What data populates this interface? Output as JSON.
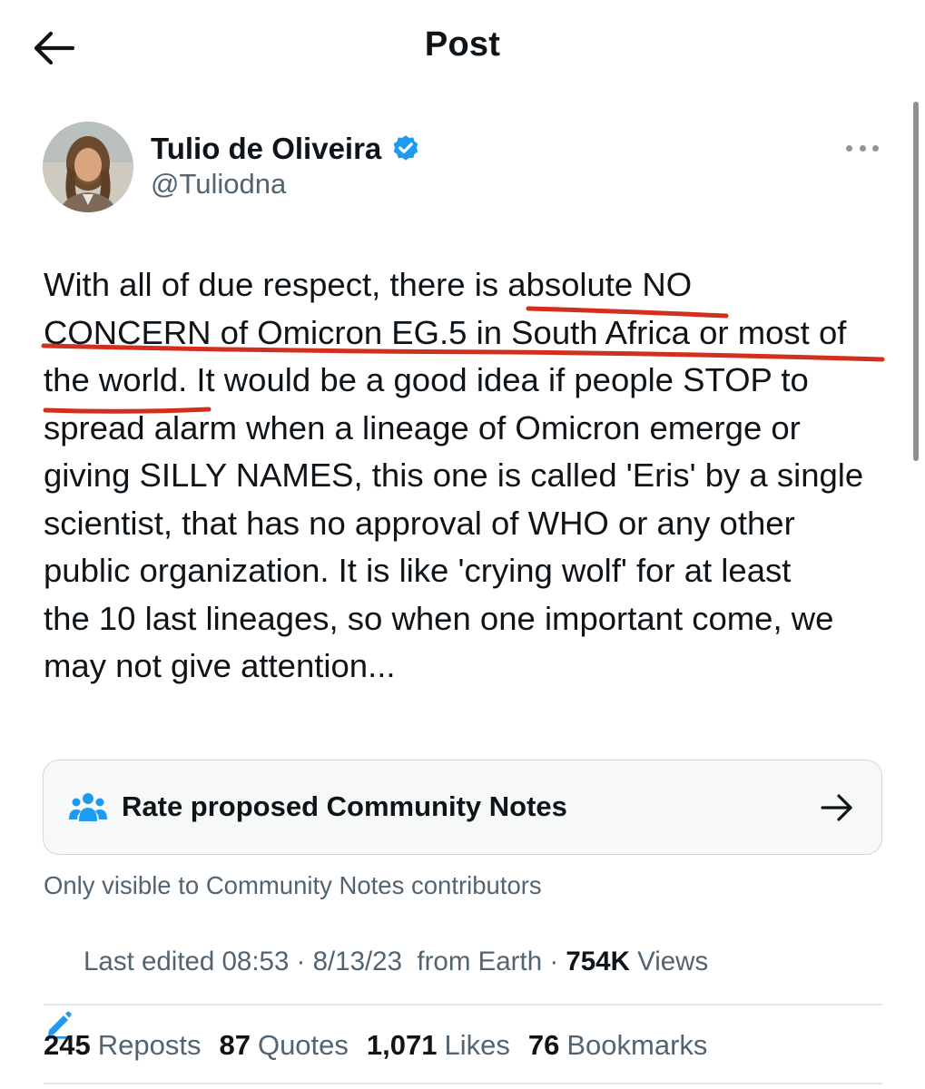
{
  "header": {
    "title": "Post"
  },
  "author": {
    "name": "Tulio de Oliveira",
    "handle": "@Tuliodna",
    "verified": true
  },
  "tweet": {
    "lines": [
      "With all of due respect, there is absolute NO",
      "CONCERN of Omicron EG.5 in South Africa or most of",
      "the world. It would be a good idea if people STOP to",
      "spread alarm when a lineage of Omicron emerge or",
      "giving SILLY NAMES, this one is called 'Eris' by a single",
      "scientist, that has no approval of WHO or any other",
      "public organization. It is like 'crying wolf' for at least",
      "the 10 last lineages, so when one important come, we",
      "may not give attention..."
    ]
  },
  "community_notes": {
    "label": "Rate proposed Community Notes",
    "visibility_note": "Only visible to Community Notes contributors"
  },
  "meta": {
    "edited_label": "Last edited 08:53 · 8/13/23",
    "source": "from Earth",
    "separator": " · ",
    "views_count": "754K",
    "views_label": " Views"
  },
  "stats": [
    {
      "count": "245",
      "label": "Reposts"
    },
    {
      "count": "87",
      "label": "Quotes"
    },
    {
      "count": "1,071",
      "label": "Likes"
    },
    {
      "count": "76",
      "label": "Bookmarks"
    }
  ],
  "colors": {
    "text_primary": "#0f1419",
    "text_secondary": "#536471",
    "verified_badge": "#1d9bf0",
    "annotation_underline": "#d32f1f",
    "notes_icon": "#1d9bf0"
  },
  "icons": {
    "back": "arrow-left-icon",
    "verified": "verified-badge-icon",
    "more": "more-dots-icon",
    "notes": "people-group-icon",
    "notes_arrow": "arrow-right-icon",
    "edited": "pencil-icon"
  }
}
